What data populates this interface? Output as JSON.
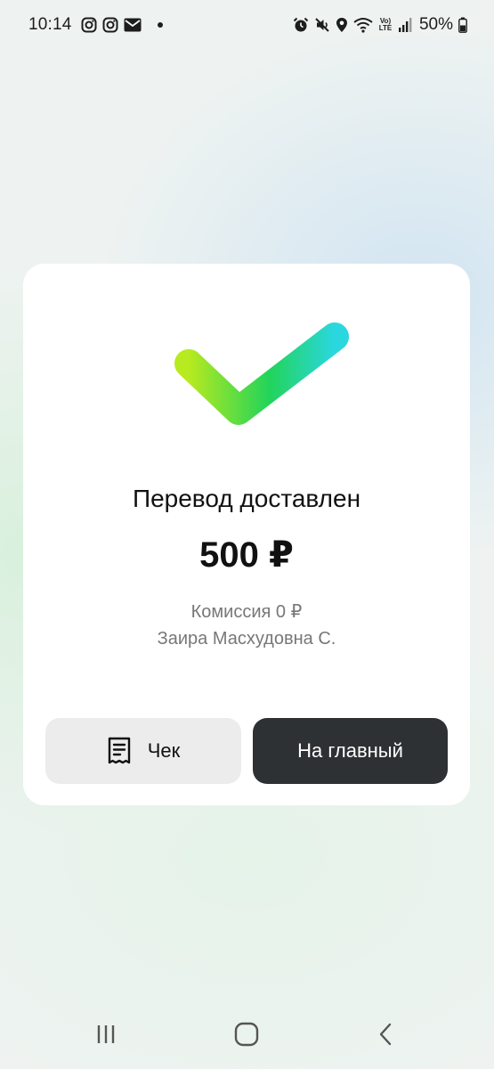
{
  "status_bar": {
    "time": "10:14",
    "battery": "50%",
    "lte_top": "Vo)",
    "lte_bottom": "LTE",
    "left_icons": [
      "instagram-icon",
      "instagram-icon",
      "mail-icon",
      "notification-dot"
    ],
    "right_icons": [
      "alarm-icon",
      "mute-icon",
      "location-icon",
      "wifi-icon",
      "volte-icon",
      "signal-icon",
      "battery-icon"
    ]
  },
  "result": {
    "title": "Перевод доставлен",
    "amount": "500 ₽",
    "commission": "Комиссия 0 ₽",
    "recipient": "Заира Масхудовна С.",
    "check_colors": [
      "#b7ea1f",
      "#22d45a",
      "#2ad7df"
    ]
  },
  "actions": {
    "receipt_label": "Чек",
    "main_label": "На главный"
  },
  "nav": {
    "icons": [
      "recent-apps-icon",
      "home-icon",
      "back-icon"
    ]
  }
}
